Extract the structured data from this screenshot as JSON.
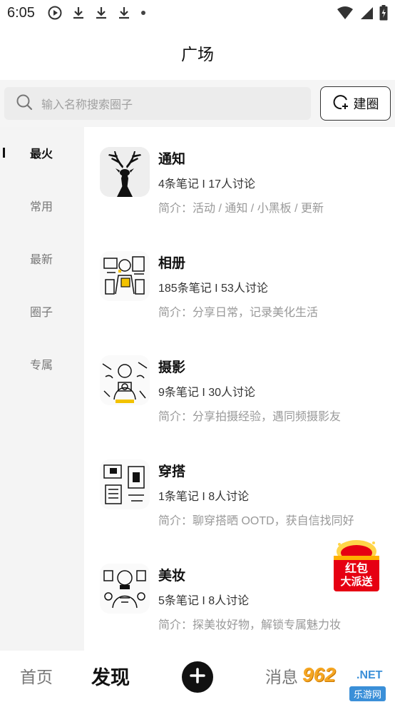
{
  "status_bar": {
    "time": "6:05",
    "left_icons": [
      "play-circle-icon",
      "download-icon",
      "download-icon",
      "download-icon",
      "dot-icon"
    ],
    "right_icons": [
      "wifi-icon",
      "signal-icon",
      "battery-icon"
    ]
  },
  "header": {
    "title": "广场"
  },
  "search": {
    "placeholder": "输入名称搜索圈子"
  },
  "create_button": {
    "label": "建圈"
  },
  "sidebar": {
    "items": [
      {
        "label": "最火",
        "active": true
      },
      {
        "label": "常用",
        "active": false
      },
      {
        "label": "最新",
        "active": false
      },
      {
        "label": "圈子",
        "active": false
      },
      {
        "label": "专属",
        "active": false
      }
    ]
  },
  "circles": [
    {
      "name": "通知",
      "stats": "4条笔记 I 17人讨论",
      "desc": "简介：活动 / 通知 / 小黑板 / 更新",
      "icon": "deer-icon"
    },
    {
      "name": "相册",
      "stats": "185条笔记 I 53人讨论",
      "desc": "简介：分享日常，记录美化生活",
      "icon": "illustration-icon"
    },
    {
      "name": "摄影",
      "stats": "9条笔记 I 30人讨论",
      "desc": "简介：分享拍摄经验，遇同频摄影友",
      "icon": "illustration-icon"
    },
    {
      "name": "穿搭",
      "stats": "1条笔记 I 8人讨论",
      "desc": "简介：聊穿搭晒 OOTD，获自信找同好",
      "icon": "illustration-icon"
    },
    {
      "name": "美妆",
      "stats": "5条笔记 I 8人讨论",
      "desc": "简介：探美妆好物，解锁专属魅力妆",
      "icon": "illustration-icon"
    }
  ],
  "floating": {
    "line1": "红包",
    "line2": "大派送"
  },
  "bottom_nav": {
    "home": "首页",
    "discover": "发现",
    "messages": "消息",
    "add_icon": "plus-icon"
  },
  "watermark": {
    "text": "962",
    "suffix": ".NET",
    "sub": "乐游网"
  },
  "colors": {
    "accent": "#111111",
    "red": "#e60012",
    "gold": "#ffd54a",
    "muted": "#999999"
  }
}
